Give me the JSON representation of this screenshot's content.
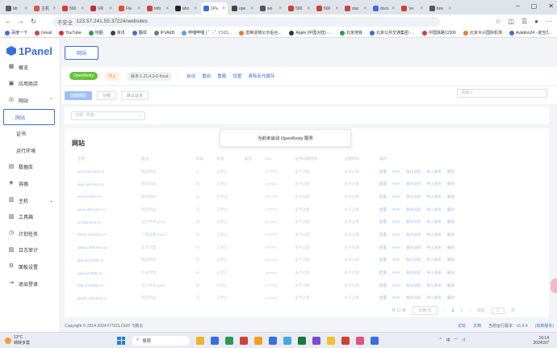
{
  "browser": {
    "tabs": [
      {
        "title": "bb",
        "color": "#5a5a5a"
      },
      {
        "title": "主机",
        "color": "#e05050"
      },
      {
        "title": "500",
        "color": "#d04030"
      },
      {
        "title": "VR",
        "color": "#c03030"
      },
      {
        "title": "Fla",
        "color": "#e0502a"
      },
      {
        "title": "Info",
        "color": "#d04040"
      },
      {
        "title": "aho",
        "color": "#222222"
      },
      {
        "title": "1Pa",
        "color": "#3a6ee0",
        "active": true
      },
      {
        "title": "ope",
        "color": "#444444"
      },
      {
        "title": "wo",
        "color": "#555555"
      },
      {
        "title": "500",
        "color": "#d04030"
      },
      {
        "title": "500",
        "color": "#d04030"
      },
      {
        "title": "star",
        "color": "#d04040"
      },
      {
        "title": "docs",
        "color": "#3a6ee0"
      },
      {
        "title": "'ex",
        "color": "#d04030"
      },
      {
        "title": "bos",
        "color": "#555555"
      }
    ],
    "url_warning": "不安全",
    "url": "123.57.241.55:37224/websites",
    "bookmarks": [
      "百度一下",
      "Gmail",
      "YouTube",
      "地图",
      "资讯",
      "翻译",
      "IFVAKB",
      "哔哩哔哩 ( ゜- ゜)つロ…",
      "雷制造物公示后台…",
      "Apple (中国大陆) -…",
      "北京地铁",
      "北京公共交通集团 -…",
      "中国铁路12306",
      "北京大兴国际机场",
      "Aviation24 - 航空2…"
    ],
    "bookmark_colors": [
      "#3a6ee0",
      "#d04040",
      "#e03030",
      "#2a9a50",
      "#444",
      "#3a6ee0",
      "#777",
      "#4aa8e0",
      "#e08030",
      "#333",
      "#2a9a50",
      "#3a6ee0",
      "#d04040",
      "#e08030",
      "#3a6ee0"
    ]
  },
  "sidebar": {
    "logo_text": "1Panel",
    "items": [
      {
        "label": "概览",
        "icon": "▦"
      },
      {
        "label": "应用商店",
        "icon": "▣"
      },
      {
        "label": "网站",
        "icon": "◎",
        "chevron": "⌃"
      },
      {
        "label": "网站",
        "sub": true,
        "active": true
      },
      {
        "label": "证书",
        "sub": true
      },
      {
        "label": "运行环境",
        "sub": true
      },
      {
        "label": "数据库",
        "icon": "▤"
      },
      {
        "label": "容器",
        "icon": "◈"
      },
      {
        "label": "主机",
        "icon": "▥",
        "chevron": "⌄"
      },
      {
        "label": "工具箱",
        "icon": "▧"
      },
      {
        "label": "计划任务",
        "icon": "◷"
      },
      {
        "label": "日志审计",
        "icon": "▨"
      },
      {
        "label": "面板设置",
        "icon": "⚙"
      },
      {
        "label": "退出登录",
        "icon": "⇥"
      }
    ]
  },
  "main": {
    "top_tab": "网站",
    "status": {
      "app": "OpenResty",
      "app_color": "#67c23a",
      "state": "停止",
      "state_color": "#e6a23c",
      "version": "版本:1.21.4.3-0-focal",
      "actions": [
        "启动",
        "重启",
        "重载",
        "设置",
        "清除反代缓存"
      ]
    },
    "buttons": [
      "创建网站",
      "分组",
      "默认站点"
    ],
    "search_placeholder": "请输入",
    "group_label": "分组",
    "group_value": "所有",
    "table_title": "网站",
    "toast": "当前未启动 OpenResty 服务",
    "columns": [
      "名称",
      "备注",
      "目录",
      "状态",
      "备份",
      "SSL",
      "证书过期时间",
      "过期时间",
      "操作"
    ],
    "rows": [
      [
        "pont.vfecsms.cn",
        "静态网站",
        "日",
        "已停止",
        "",
        "HTTPS",
        "永不过期",
        "永不过期"
      ],
      [
        "step.vfecsms.cn",
        "静态网站",
        "日",
        "已停止",
        "",
        "HTTPS",
        "永不过期",
        "永不过期"
      ],
      [
        "stk.vfecsms.cn",
        "静态网站",
        "日",
        "已停止",
        "",
        "HTTPS",
        "永不过期",
        "永不过期"
      ],
      [
        "www.vfecsms.cn",
        "静态网站",
        "日",
        "已停止",
        "",
        "HTTPS",
        "永不过期",
        "永不过期"
      ],
      [
        "ve.vfecsms.cn",
        "运行环境 [php]",
        "日",
        "已停止",
        "",
        "HTTPS",
        "永不过期",
        "永不过期"
      ],
      [
        "home.vfecsms.cn",
        "一键部署 [halo]",
        "日",
        "已停止",
        "",
        "HTTPS",
        "永不过期",
        "永不过期"
      ],
      [
        "pdsua.vfecsms.cn",
        "反向代理",
        "日",
        "已停止",
        "",
        "HTTPS",
        "永不过期",
        "永不过期"
      ],
      [
        "plan.jnz2005.cn",
        "静态网站",
        "日",
        "已停止",
        "",
        "HTTPS",
        "永不过期",
        "永不过期"
      ],
      [
        "dali.jnz2005.cn",
        "反向代理",
        "日",
        "已停止",
        "",
        "HTTPS",
        "永不过期",
        "永不过期"
      ],
      [
        "bak.sca2005.cn",
        "运行环境 [php]",
        "日",
        "已停止",
        "",
        "HTTPS",
        "永不过期",
        "永不过期"
      ],
      [
        "public.vfecsms.cn",
        "静态网站",
        "日",
        "已停止",
        "",
        "HTTPS",
        "永不过期",
        "永不过期"
      ]
    ],
    "row_ops": [
      "配置",
      "WAF",
      "备份访问",
      "导入备份",
      "删除"
    ],
    "pager": {
      "total": "共 11 条",
      "size": "10条/页",
      "pages": [
        "1",
        "2"
      ],
      "goto": "前往",
      "page_input": "1",
      "page_unit": "页"
    }
  },
  "footer": {
    "copyright": "Copyright © 2014-2024 FIT2CLOUD 飞致云",
    "links": [
      "论坛",
      "文档"
    ],
    "version_label": "当前运行版本：v1.9.4",
    "update": "(有新版本)"
  },
  "taskbar": {
    "temp": "13°C",
    "weather": "晴转多雲",
    "search": "搜索",
    "app_colors": [
      "#f0b030",
      "#3a6ee0",
      "#2a9a50",
      "#d04040",
      "#f0a020",
      "#3a6ee0",
      "#4aa8e0",
      "#1a7a3a",
      "#7a4ad0",
      "#f0c030",
      "#d04030",
      "#e05080",
      "#3a6ee0"
    ],
    "ime": "中",
    "time": "16:14",
    "date": "2024/3/7"
  }
}
